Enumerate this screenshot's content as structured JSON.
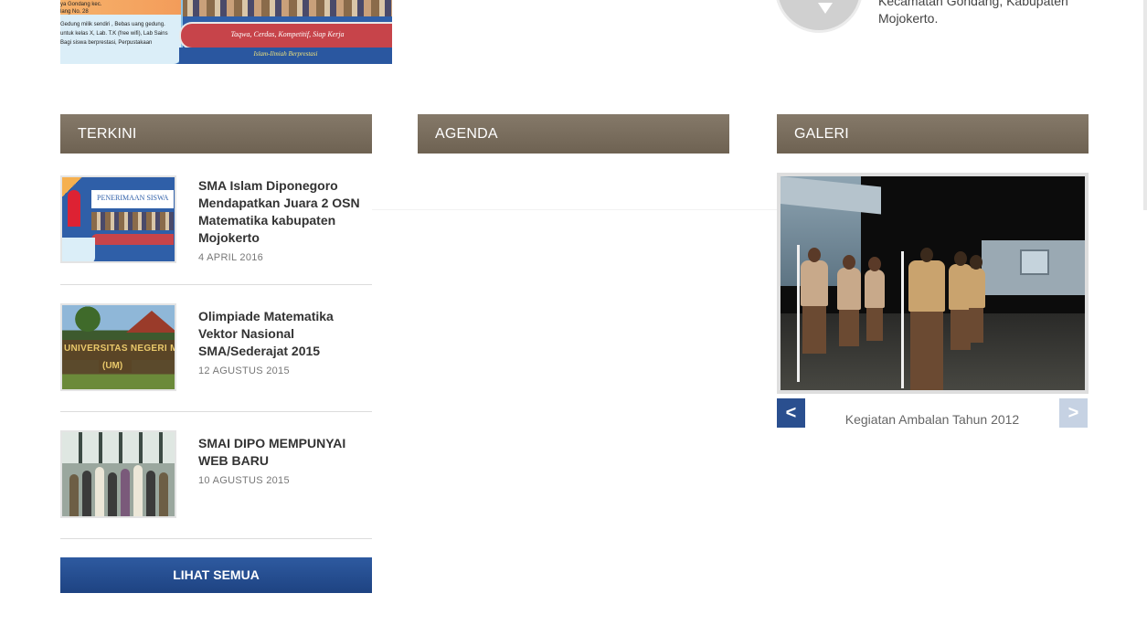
{
  "top_banner": {
    "info_lines": [
      "Gedung milik sendiri , Bebas uang gedung.",
      "untuk kelas X, Lab. T.K (free wifi), Lab Sains",
      "Bagi siswa berprestasi, Perpustakaan",
      "ya Gondang kec.",
      "lang No. 28"
    ],
    "ribbon_text": "Taqwa, Cerdas, Kompetitif, Siap Kerja",
    "sub_text": "Islam-Ilmiah Berprestasi"
  },
  "contact": {
    "address": "Kecamatan Gondang, Kabupaten Mojokerto."
  },
  "sections": {
    "news_title": "TERKINI",
    "agenda_title": "AGENDA",
    "gallery_title": "GALERI"
  },
  "news": [
    {
      "title": "SMA Islam Diponegoro Mendapatkan Juara 2 OSN Matematika kabupaten Mojokerto",
      "date": "4 APRIL 2016",
      "thumb_text": "PENERIMAAN SISWA"
    },
    {
      "title": "Olimpiade Matematika Vektor Nasional SMA/Sederajat 2015",
      "date": "12 AGUSTUS 2015",
      "thumb_text": "UNIVERSITAS NEGERI MALANG",
      "thumb_text2": "(UM)"
    },
    {
      "title": "SMAI DIPO MEMPUNYAI WEB BARU",
      "date": "10 AGUSTUS 2015"
    }
  ],
  "buttons": {
    "see_all": "LIHAT SEMUA",
    "prev": "<",
    "next": ">"
  },
  "gallery": {
    "caption": "Kegiatan Ambalan Tahun 2012"
  },
  "colors": {
    "header_bg": "#7a6e5e",
    "button_bg": "#244d8f",
    "prev_bg": "#2a4f8f",
    "next_bg": "#c6d2e3"
  }
}
